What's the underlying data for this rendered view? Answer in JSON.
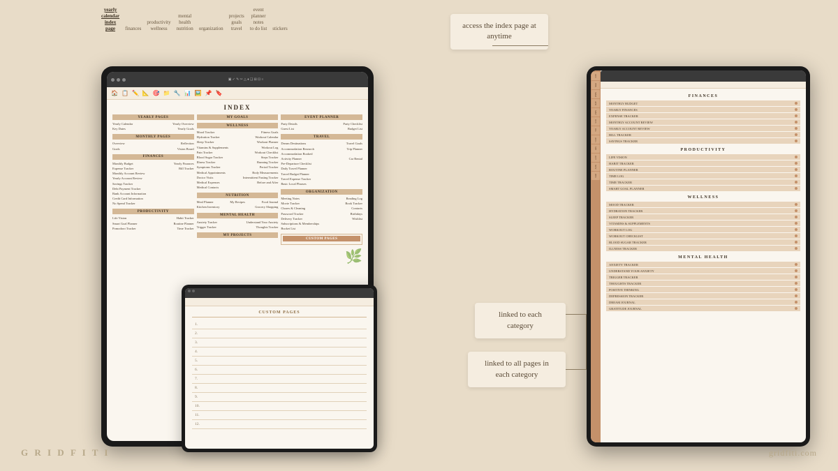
{
  "brand": {
    "left": "G R I D F I T I",
    "right": "gridfiti.com"
  },
  "callouts": {
    "index": "access the index\npage at anytime",
    "linked_category": "linked to each\ncategory",
    "linked_pages": "linked to all\npages in each\ncategory"
  },
  "top_nav": {
    "items": [
      {
        "label": "yearly\ncalendar\nindex\npage",
        "active": true
      },
      {
        "label": "finances",
        "active": false
      },
      {
        "label": "productivity\nwellness",
        "active": false
      },
      {
        "label": "mental\nhealth\nnutrition",
        "active": false
      },
      {
        "label": "organization",
        "active": false
      },
      {
        "label": "projects\ngoals\ntravel",
        "active": false
      },
      {
        "label": "event\nplanner\nnotes\nto do list",
        "active": false
      },
      {
        "label": "stickers",
        "active": false
      }
    ]
  },
  "index_page": {
    "title": "INDEX",
    "sections": {
      "yearly": {
        "title": "YEARLY PAGES",
        "items": [
          "Yearly Calendar",
          "Yearly Overview",
          "Key Dates",
          "Yearly Goals"
        ]
      },
      "monthly": {
        "title": "MONTHLY PAGES",
        "items": [
          "Overview",
          "Reflection",
          "Goals",
          "Vision Board"
        ]
      },
      "finances": {
        "title": "FINANCES",
        "items": [
          "Monthly Budget",
          "Yearly Finances",
          "Expense Tracker",
          "Bill Tracker",
          "Monthly Account Review",
          "Yearly Account Review",
          "Savings Tracker",
          "Debt Payment Tracker",
          "Bank Account Information",
          "Credit Card Information",
          "No Spend Tracker"
        ]
      },
      "productivity": {
        "title": "PRODUCTIVITY",
        "items": [
          "Life Vision",
          "Habit Tracker",
          "Smart Goal Planner",
          "Routine Planner",
          "Pomodoro Tracker",
          "Time Tracker"
        ]
      },
      "wellness": {
        "title": "WELLNESS",
        "items": [
          "Mood Tracker",
          "Fitness Goals",
          "Hydration Tracker",
          "Workout Calendar",
          "Sleep Tracker",
          "Workout Planner",
          "Vitamins & Supplements",
          "Workout Log",
          "Pain Tracker",
          "Workout Checklist",
          "Blood Sugar Tracker",
          "Steps Tracker",
          "Illness Tracker",
          "Running Tracker",
          "Symptoms Tracker",
          "Period Tracker",
          "Medical Appointments",
          "Body Measurements",
          "Doctor Visits",
          "Intermittent Fasting Tracker",
          "Medical Expenses",
          "Before and After",
          "Medical Contacts"
        ]
      },
      "nutrition": {
        "title": "NUTRITION",
        "items": [
          "Meal Planner",
          "My Recipes",
          "Food Journal",
          "Kitchen Inventory",
          "Grocery Shopping"
        ]
      },
      "mental_health": {
        "title": "MENTAL HEALTH",
        "items": [
          "Anxiety Tracker",
          "Understand Your Anxiety",
          "Trigger Tracker",
          "Thoughts Tracker"
        ]
      },
      "my_goals": {
        "title": "MY GOALS"
      },
      "my_projects": {
        "title": "MY PROJECTS"
      },
      "event_planner": {
        "title": "EVENT PLANNER",
        "items": [
          "Party Details",
          "Party Checklist",
          "Guest List",
          "Budget List"
        ]
      },
      "travel": {
        "title": "TRAVEL",
        "items": [
          "Dream Destinations",
          "Travel Goals",
          "Accommodation Research",
          "Trip Planner",
          "Accommodation Booked",
          "Activity Planner",
          "Car Rental",
          "Pre-Departure Checklist",
          "Daily Travel Planner",
          "Travel Budget Planner",
          "Travel Expense Tracker",
          "Basic Local Phrases"
        ]
      },
      "organization": {
        "title": "ORGANIZATION",
        "items": [
          "Meeting Notes",
          "Reading Log",
          "Movie Tracker",
          "Book Tracker",
          "Chores & Cleaning",
          "Contacts",
          "Password Tracker",
          "Birthdays",
          "Delivery Tracker",
          "Wishlist",
          "Subscriptions & Memberships",
          "Bucket List"
        ]
      },
      "custom_pages": {
        "title": "CUSTOM PAGES",
        "lines": [
          "1.",
          "2.",
          "3.",
          "4.",
          "5.",
          "6.",
          "7.",
          "8.",
          "9.",
          "10.",
          "11.",
          "12."
        ]
      }
    }
  },
  "right_panel": {
    "sections": [
      {
        "title": "FINANCES",
        "items": [
          "MONTHLY BUDGET",
          "YEARLY FINANCES",
          "EXPENSE TRACKER",
          "MONTHLY ACCOUNT REVIEW",
          "YEARLY ACCOUNT REVIEW",
          "BILL TRACKER",
          "SAVINGS TRACKER"
        ]
      },
      {
        "title": "PRODUCTIVITY",
        "items": [
          "LIFE VISION",
          "HABIT TRACKER",
          "ROUTINE PLANNER",
          "TIME LOG",
          "TIME TRACKER",
          "SMART GOAL PLANNER"
        ]
      },
      {
        "title": "WELLNESS",
        "items": [
          "MOOD TRACKER",
          "HYDRATION TRACKER",
          "SLEEP TRACKER",
          "VITAMINS & SUPPLEMENTS",
          "WORKOUT LOG",
          "WORKOUT CHECKLIST",
          "BLOOD SUGAR TRACKER",
          "ILLNESS TRACKER"
        ]
      },
      {
        "title": "MENTAL HEALTH",
        "items": [
          "ANXIETY TRACKER",
          "UNDERSTAND YOUR ANXIETY",
          "TRIGGER TRACKER",
          "THOUGHTS TRACKER",
          "POSITIVE THINKING",
          "DEPRESSION TRACKER",
          "DREAM JOURNAL",
          "GRATITUDE JOURNAL"
        ]
      }
    ],
    "sidebar_tabs": [
      "JAN",
      "FEB",
      "MAR",
      "APR",
      "MAY",
      "JUN",
      "JUL",
      "AUG",
      "SEP",
      "OCT",
      "NOV",
      "DEC"
    ]
  }
}
